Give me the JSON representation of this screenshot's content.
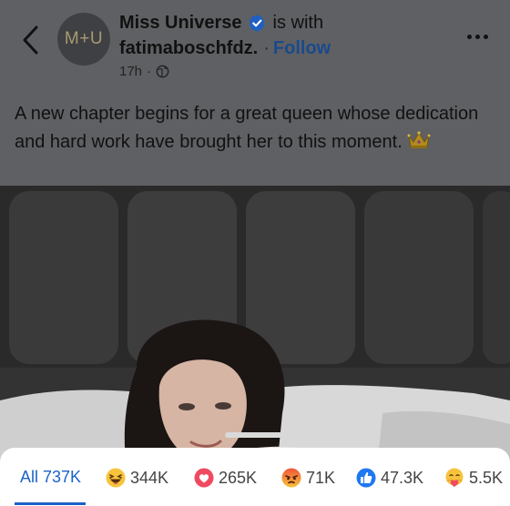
{
  "header": {
    "avatar_text": "M+U",
    "page_name": "Miss Universe",
    "with_text": "is with",
    "tagged_user": "fatimaboschfdz.",
    "separator": "·",
    "follow_label": "Follow",
    "time": "17h",
    "time_separator": "·"
  },
  "post": {
    "caption": "A new chapter begins for a great queen whose dedication and hard work have brought her to this moment."
  },
  "reactions": {
    "tabs": [
      {
        "label": "All",
        "count": "737K",
        "icon": "none"
      },
      {
        "count": "344K",
        "icon": "haha-icon"
      },
      {
        "count": "265K",
        "icon": "love-icon"
      },
      {
        "count": "71K",
        "icon": "angry-icon"
      },
      {
        "count": "47.3K",
        "icon": "like-icon"
      },
      {
        "count": "5.5K",
        "icon": "care-icon"
      }
    ]
  },
  "colors": {
    "accent": "#1c63c7",
    "follow": "#1a4a8c",
    "overlay": "#5f6063"
  }
}
